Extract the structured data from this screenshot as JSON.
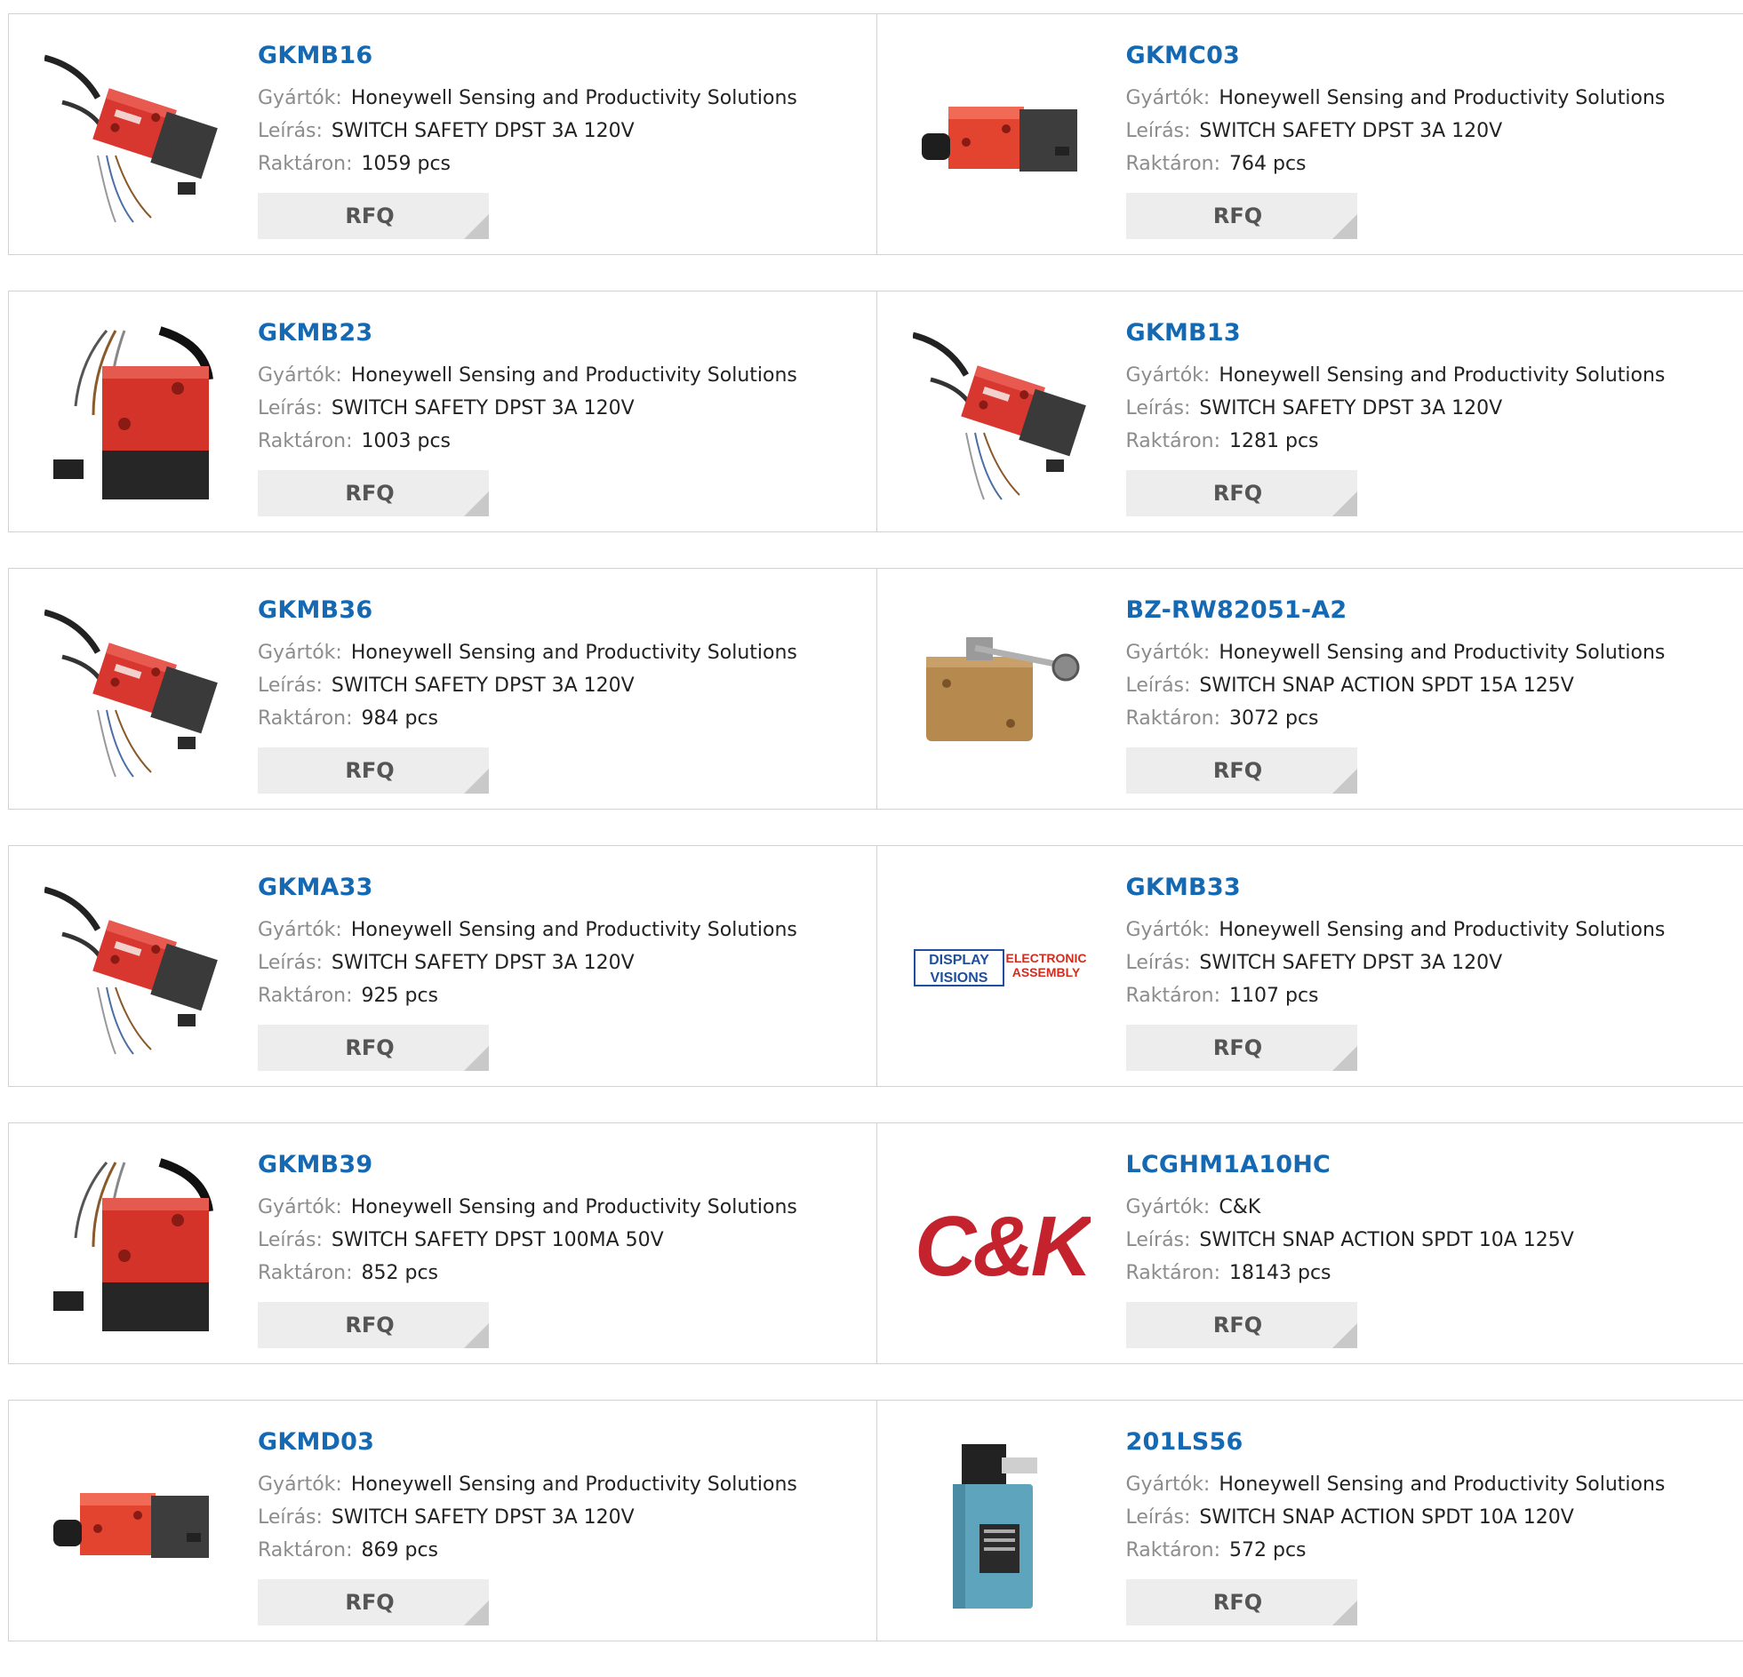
{
  "labels": {
    "manufacturer": "Gyártók:",
    "description": "Leírás:",
    "stock": "Raktáron:",
    "rfq": "RFQ"
  },
  "products": [
    {
      "name": "GKMB16",
      "manufacturer": "Honeywell Sensing and Productivity Solutions",
      "description": "SWITCH SAFETY DPST 3A 120V",
      "stock": "1059 pcs",
      "image": "honeywell-safety-switch-red-cable"
    },
    {
      "name": "GKMC03",
      "manufacturer": "Honeywell Sensing and Productivity Solutions",
      "description": "SWITCH SAFETY DPST 3A 120V",
      "stock": "764 pcs",
      "image": "honeywell-safety-switch-red-connector"
    },
    {
      "name": "GKMB23",
      "manufacturer": "Honeywell Sensing and Productivity Solutions",
      "description": "SWITCH SAFETY DPST 3A 120V",
      "stock": "1003 pcs",
      "image": "honeywell-safety-switch-red-large"
    },
    {
      "name": "GKMB13",
      "manufacturer": "Honeywell Sensing and Productivity Solutions",
      "description": "SWITCH SAFETY DPST 3A 120V",
      "stock": "1281 pcs",
      "image": "honeywell-safety-switch-red-cable"
    },
    {
      "name": "GKMB36",
      "manufacturer": "Honeywell Sensing and Productivity Solutions",
      "description": "SWITCH SAFETY DPST 3A 120V",
      "stock": "984 pcs",
      "image": "honeywell-safety-switch-red-cable"
    },
    {
      "name": "BZ-RW82051-A2",
      "manufacturer": "Honeywell Sensing and Productivity Solutions",
      "description": "SWITCH SNAP ACTION SPDT 15A 125V",
      "stock": "3072 pcs",
      "image": "snap-action-roller-switch"
    },
    {
      "name": "GKMA33",
      "manufacturer": "Honeywell Sensing and Productivity Solutions",
      "description": "SWITCH SAFETY DPST 3A 120V",
      "stock": "925 pcs",
      "image": "honeywell-safety-switch-red-cable"
    },
    {
      "name": "GKMB33",
      "manufacturer": "Honeywell Sensing and Productivity Solutions",
      "description": "SWITCH SAFETY DPST 3A 120V",
      "stock": "1107 pcs",
      "image": "display-visions-logo",
      "logo_text": [
        "DISPLAY",
        "VISIONS",
        "ELECTRONIC",
        "ASSEMBLY"
      ]
    },
    {
      "name": "GKMB39",
      "manufacturer": "Honeywell Sensing and Productivity Solutions",
      "description": "SWITCH SAFETY DPST 100MA 50V",
      "stock": "852 pcs",
      "image": "honeywell-safety-switch-red-large"
    },
    {
      "name": "LCGHM1A10HC",
      "manufacturer": "C&K",
      "description": "SWITCH SNAP ACTION SPDT 10A 125V",
      "stock": "18143 pcs",
      "image": "ck-logo",
      "logo_text": [
        "C&K"
      ]
    },
    {
      "name": "GKMD03",
      "manufacturer": "Honeywell Sensing and Productivity Solutions",
      "description": "SWITCH SAFETY DPST 3A 120V",
      "stock": "869 pcs",
      "image": "honeywell-safety-switch-red-connector"
    },
    {
      "name": "201LS56",
      "manufacturer": "Honeywell Sensing and Productivity Solutions",
      "description": "SWITCH SNAP ACTION SPDT 10A 120V",
      "stock": "572 pcs",
      "image": "limit-switch-blue"
    }
  ],
  "colors": {
    "link": "#1568b2",
    "label": "#8c8c8c",
    "button_bg": "#ededed",
    "border": "#d2d2d2"
  }
}
